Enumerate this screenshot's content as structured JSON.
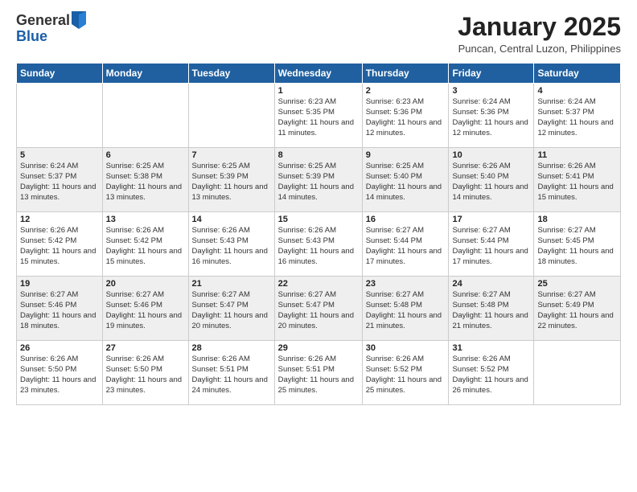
{
  "logo": {
    "general": "General",
    "blue": "Blue"
  },
  "header": {
    "month": "January 2025",
    "location": "Puncan, Central Luzon, Philippines"
  },
  "days_of_week": [
    "Sunday",
    "Monday",
    "Tuesday",
    "Wednesday",
    "Thursday",
    "Friday",
    "Saturday"
  ],
  "weeks": [
    [
      {
        "day": "",
        "info": ""
      },
      {
        "day": "",
        "info": ""
      },
      {
        "day": "",
        "info": ""
      },
      {
        "day": "1",
        "info": "Sunrise: 6:23 AM\nSunset: 5:35 PM\nDaylight: 11 hours and 11 minutes."
      },
      {
        "day": "2",
        "info": "Sunrise: 6:23 AM\nSunset: 5:36 PM\nDaylight: 11 hours and 12 minutes."
      },
      {
        "day": "3",
        "info": "Sunrise: 6:24 AM\nSunset: 5:36 PM\nDaylight: 11 hours and 12 minutes."
      },
      {
        "day": "4",
        "info": "Sunrise: 6:24 AM\nSunset: 5:37 PM\nDaylight: 11 hours and 12 minutes."
      }
    ],
    [
      {
        "day": "5",
        "info": "Sunrise: 6:24 AM\nSunset: 5:37 PM\nDaylight: 11 hours and 13 minutes."
      },
      {
        "day": "6",
        "info": "Sunrise: 6:25 AM\nSunset: 5:38 PM\nDaylight: 11 hours and 13 minutes."
      },
      {
        "day": "7",
        "info": "Sunrise: 6:25 AM\nSunset: 5:39 PM\nDaylight: 11 hours and 13 minutes."
      },
      {
        "day": "8",
        "info": "Sunrise: 6:25 AM\nSunset: 5:39 PM\nDaylight: 11 hours and 14 minutes."
      },
      {
        "day": "9",
        "info": "Sunrise: 6:25 AM\nSunset: 5:40 PM\nDaylight: 11 hours and 14 minutes."
      },
      {
        "day": "10",
        "info": "Sunrise: 6:26 AM\nSunset: 5:40 PM\nDaylight: 11 hours and 14 minutes."
      },
      {
        "day": "11",
        "info": "Sunrise: 6:26 AM\nSunset: 5:41 PM\nDaylight: 11 hours and 15 minutes."
      }
    ],
    [
      {
        "day": "12",
        "info": "Sunrise: 6:26 AM\nSunset: 5:42 PM\nDaylight: 11 hours and 15 minutes."
      },
      {
        "day": "13",
        "info": "Sunrise: 6:26 AM\nSunset: 5:42 PM\nDaylight: 11 hours and 15 minutes."
      },
      {
        "day": "14",
        "info": "Sunrise: 6:26 AM\nSunset: 5:43 PM\nDaylight: 11 hours and 16 minutes."
      },
      {
        "day": "15",
        "info": "Sunrise: 6:26 AM\nSunset: 5:43 PM\nDaylight: 11 hours and 16 minutes."
      },
      {
        "day": "16",
        "info": "Sunrise: 6:27 AM\nSunset: 5:44 PM\nDaylight: 11 hours and 17 minutes."
      },
      {
        "day": "17",
        "info": "Sunrise: 6:27 AM\nSunset: 5:44 PM\nDaylight: 11 hours and 17 minutes."
      },
      {
        "day": "18",
        "info": "Sunrise: 6:27 AM\nSunset: 5:45 PM\nDaylight: 11 hours and 18 minutes."
      }
    ],
    [
      {
        "day": "19",
        "info": "Sunrise: 6:27 AM\nSunset: 5:46 PM\nDaylight: 11 hours and 18 minutes."
      },
      {
        "day": "20",
        "info": "Sunrise: 6:27 AM\nSunset: 5:46 PM\nDaylight: 11 hours and 19 minutes."
      },
      {
        "day": "21",
        "info": "Sunrise: 6:27 AM\nSunset: 5:47 PM\nDaylight: 11 hours and 20 minutes."
      },
      {
        "day": "22",
        "info": "Sunrise: 6:27 AM\nSunset: 5:47 PM\nDaylight: 11 hours and 20 minutes."
      },
      {
        "day": "23",
        "info": "Sunrise: 6:27 AM\nSunset: 5:48 PM\nDaylight: 11 hours and 21 minutes."
      },
      {
        "day": "24",
        "info": "Sunrise: 6:27 AM\nSunset: 5:48 PM\nDaylight: 11 hours and 21 minutes."
      },
      {
        "day": "25",
        "info": "Sunrise: 6:27 AM\nSunset: 5:49 PM\nDaylight: 11 hours and 22 minutes."
      }
    ],
    [
      {
        "day": "26",
        "info": "Sunrise: 6:26 AM\nSunset: 5:50 PM\nDaylight: 11 hours and 23 minutes."
      },
      {
        "day": "27",
        "info": "Sunrise: 6:26 AM\nSunset: 5:50 PM\nDaylight: 11 hours and 23 minutes."
      },
      {
        "day": "28",
        "info": "Sunrise: 6:26 AM\nSunset: 5:51 PM\nDaylight: 11 hours and 24 minutes."
      },
      {
        "day": "29",
        "info": "Sunrise: 6:26 AM\nSunset: 5:51 PM\nDaylight: 11 hours and 25 minutes."
      },
      {
        "day": "30",
        "info": "Sunrise: 6:26 AM\nSunset: 5:52 PM\nDaylight: 11 hours and 25 minutes."
      },
      {
        "day": "31",
        "info": "Sunrise: 6:26 AM\nSunset: 5:52 PM\nDaylight: 11 hours and 26 minutes."
      },
      {
        "day": "",
        "info": ""
      }
    ]
  ]
}
